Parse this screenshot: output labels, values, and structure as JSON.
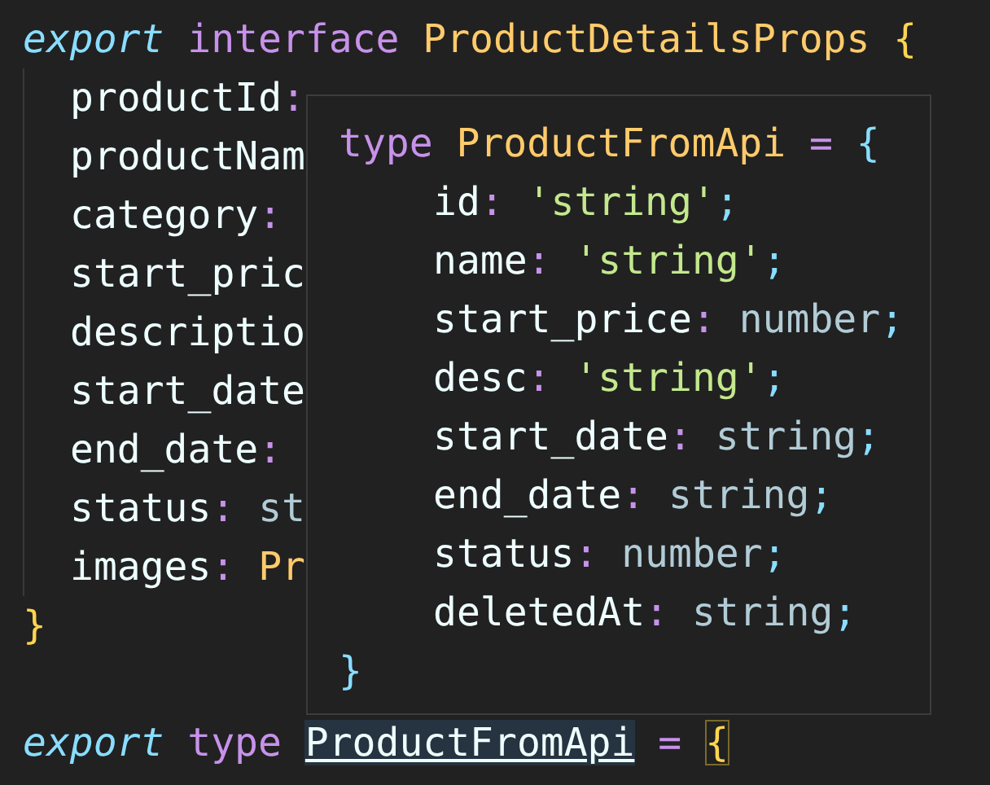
{
  "editor": {
    "declarations": [
      {
        "lines": [
          {
            "tokens": [
              {
                "text": "export",
                "kind": "storage"
              },
              {
                "text": "interface",
                "kind": "keyword"
              },
              {
                "text": "ProductDetailsProps",
                "kind": "type"
              },
              {
                "text": "{",
                "kind": "brace"
              }
            ],
            "children": [
              {
                "tokens": [
                  {
                    "text": "productId",
                    "kind": "prop"
                  },
                  {
                    "text": ":",
                    "kind": "colon"
                  }
                ]
              },
              {
                "tokens": [
                  {
                    "text": "productNam",
                    "kind": "prop"
                  }
                ]
              },
              {
                "tokens": [
                  {
                    "text": "category",
                    "kind": "prop"
                  },
                  {
                    "text": ":",
                    "kind": "colon"
                  }
                ]
              },
              {
                "tokens": [
                  {
                    "text": "start_pric",
                    "kind": "prop"
                  }
                ]
              },
              {
                "tokens": [
                  {
                    "text": "descriptio",
                    "kind": "prop"
                  }
                ]
              },
              {
                "tokens": [
                  {
                    "text": "start_date",
                    "kind": "prop"
                  }
                ]
              },
              {
                "tokens": [
                  {
                    "text": "end_date",
                    "kind": "prop"
                  },
                  {
                    "text": ":",
                    "kind": "colon"
                  }
                ]
              },
              {
                "tokens": [
                  {
                    "text": "status",
                    "kind": "prop"
                  },
                  {
                    "text": ":",
                    "kind": "colon"
                  },
                  {
                    "text": "st",
                    "kind": "prim"
                  }
                ]
              },
              {
                "tokens": [
                  {
                    "text": "images",
                    "kind": "prop"
                  },
                  {
                    "text": ":",
                    "kind": "colon"
                  },
                  {
                    "text": "Pr",
                    "kind": "type"
                  }
                ]
              }
            ]
          },
          {
            "tokens": [
              {
                "text": "}",
                "kind": "brace"
              }
            ]
          }
        ]
      },
      {
        "lines": [
          {
            "tokens": [
              {
                "text": "export",
                "kind": "storage",
                "hovered": false,
                "matched": false
              },
              {
                "text": "type",
                "kind": "keyword",
                "hovered": false,
                "matched": false
              },
              {
                "text": "ProductFromApi",
                "kind": "type-plain",
                "hovered": true,
                "matched": false
              },
              {
                "text": "=",
                "kind": "keyword",
                "hovered": false,
                "matched": false
              },
              {
                "text": "{",
                "kind": "brace",
                "hovered": false,
                "matched": true
              }
            ]
          }
        ]
      }
    ]
  },
  "hover": {
    "lines": [
      {
        "tokens": [
          {
            "text": "type",
            "kind": "keyword"
          },
          {
            "text": "ProductFromApi",
            "kind": "type"
          },
          {
            "text": "=",
            "kind": "keyword"
          },
          {
            "text": "{",
            "kind": "brace-blue"
          }
        ],
        "children": [
          {
            "tokens": [
              {
                "text": "id",
                "kind": "prop"
              },
              {
                "text": ":",
                "kind": "colon"
              },
              {
                "text": "'string'",
                "kind": "string"
              },
              {
                "text": ";",
                "kind": "semi"
              }
            ]
          },
          {
            "tokens": [
              {
                "text": "name",
                "kind": "prop"
              },
              {
                "text": ":",
                "kind": "colon"
              },
              {
                "text": "'string'",
                "kind": "string"
              },
              {
                "text": ";",
                "kind": "semi"
              }
            ]
          },
          {
            "tokens": [
              {
                "text": "start_price",
                "kind": "prop"
              },
              {
                "text": ":",
                "kind": "colon"
              },
              {
                "text": "number",
                "kind": "prim"
              },
              {
                "text": ";",
                "kind": "semi"
              }
            ]
          },
          {
            "tokens": [
              {
                "text": "desc",
                "kind": "prop"
              },
              {
                "text": ":",
                "kind": "colon"
              },
              {
                "text": "'string'",
                "kind": "string"
              },
              {
                "text": ";",
                "kind": "semi"
              }
            ]
          },
          {
            "tokens": [
              {
                "text": "start_date",
                "kind": "prop"
              },
              {
                "text": ":",
                "kind": "colon"
              },
              {
                "text": "string",
                "kind": "prim"
              },
              {
                "text": ";",
                "kind": "semi"
              }
            ]
          },
          {
            "tokens": [
              {
                "text": "end_date",
                "kind": "prop"
              },
              {
                "text": ":",
                "kind": "colon"
              },
              {
                "text": "string",
                "kind": "prim"
              },
              {
                "text": ";",
                "kind": "semi"
              }
            ]
          },
          {
            "tokens": [
              {
                "text": "status",
                "kind": "prop"
              },
              {
                "text": ":",
                "kind": "colon"
              },
              {
                "text": "number",
                "kind": "prim"
              },
              {
                "text": ";",
                "kind": "semi"
              }
            ]
          },
          {
            "tokens": [
              {
                "text": "deletedAt",
                "kind": "prop"
              },
              {
                "text": ":",
                "kind": "colon"
              },
              {
                "text": "string",
                "kind": "prim"
              },
              {
                "text": ";",
                "kind": "semi"
              }
            ]
          }
        ]
      },
      {
        "tokens": [
          {
            "text": "}",
            "kind": "brace-blue"
          }
        ]
      }
    ]
  }
}
